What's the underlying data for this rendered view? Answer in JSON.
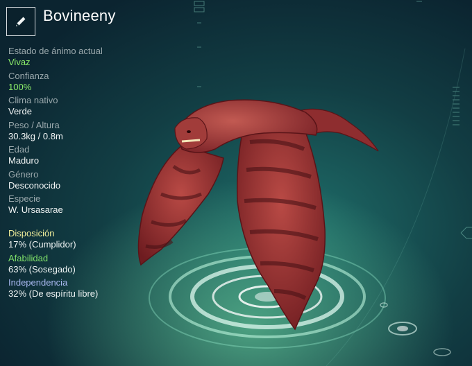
{
  "header": {
    "creature_name": "Bovineeny",
    "edit_icon": "pencil-icon"
  },
  "stats": [
    {
      "label": "Estado de ánimo actual",
      "value": "Vivaz",
      "highlight": true
    },
    {
      "label": "Confianza",
      "value": "100%",
      "highlight": true
    },
    {
      "label": "Clima nativo",
      "value": "Verde",
      "highlight": false
    },
    {
      "label": "Peso / Altura",
      "value": "30.3kg / 0.8m",
      "highlight": false
    },
    {
      "label": "Edad",
      "value": "Maduro",
      "highlight": false
    },
    {
      "label": "Género",
      "value": "Desconocido",
      "highlight": false
    },
    {
      "label": "Especie",
      "value": "W. Ursasarae",
      "highlight": false
    }
  ],
  "traits": [
    {
      "label": "Disposición",
      "value": "17% (Cumplidor)",
      "color": "#f1ee9a"
    },
    {
      "label": "Afabilidad",
      "value": "63% (Sosegado)",
      "color": "#7fe06a"
    },
    {
      "label": "Independencia",
      "value": "32% (De espíritu libre)",
      "color": "#a9b8f0"
    }
  ],
  "colors": {
    "mood_value": "#8ef06a",
    "creature_body": "#8c2a2c",
    "platform_glow": "#d8fff0"
  }
}
